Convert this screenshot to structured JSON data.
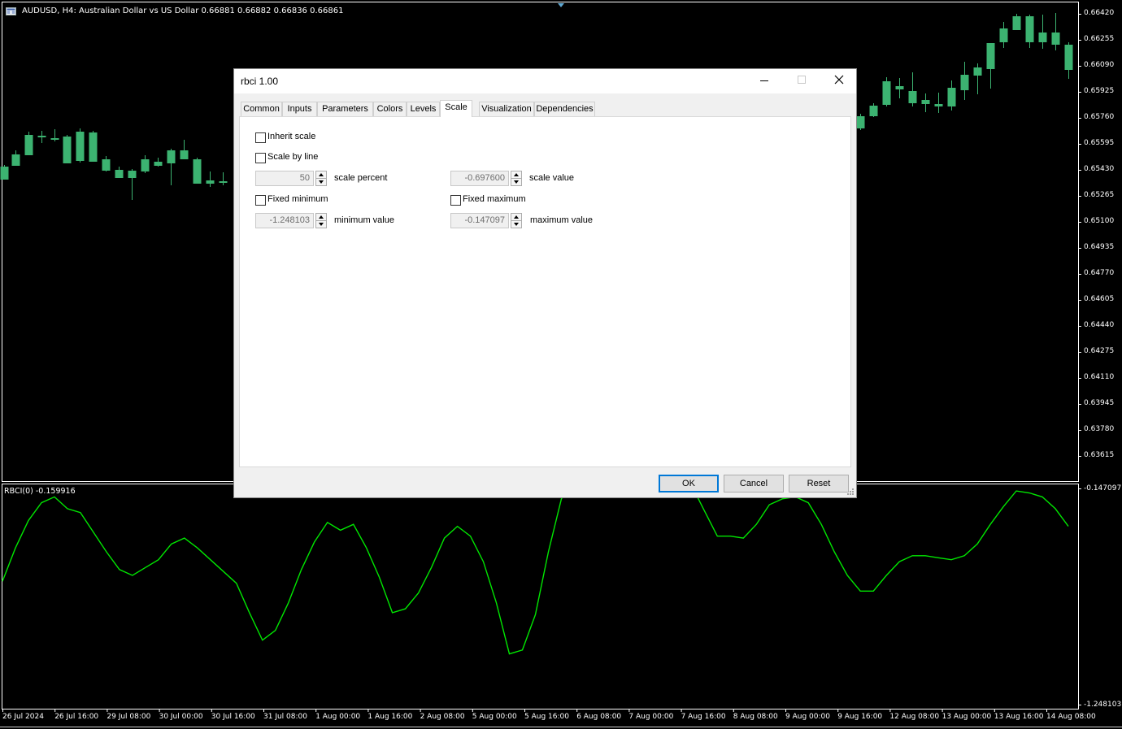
{
  "chart": {
    "title": "AUDUSD, H4:  Australian Dollar vs US Dollar  0.66881 0.66882 0.66836 0.66861",
    "indicator_title": "RBCI(0) -0.159916",
    "colors": {
      "bull": "#3cb371",
      "bear": "#ff3b0f",
      "line": "#00e600",
      "grid": "#ffffff"
    },
    "price_labels": [
      "0.66420",
      "0.66255",
      "0.66090",
      "0.65925",
      "0.65760",
      "0.65595",
      "0.65430",
      "0.65265",
      "0.65100",
      "0.64935",
      "0.64770",
      "0.64605",
      "0.64440",
      "0.64275",
      "0.64110",
      "0.63945",
      "0.63780",
      "0.63615"
    ],
    "indicator_labels": {
      "max": "-0.147097",
      "min": "-1.248103"
    },
    "time_labels": [
      "26 Jul 2024",
      "26 Jul 16:00",
      "29 Jul 08:00",
      "30 Jul 00:00",
      "30 Jul 16:00",
      "31 Jul 08:00",
      "1 Aug 00:00",
      "1 Aug 16:00",
      "2 Aug 08:00",
      "5 Aug 00:00",
      "5 Aug 16:00",
      "6 Aug 08:00",
      "7 Aug 00:00",
      "7 Aug 16:00",
      "8 Aug 08:00",
      "9 Aug 00:00",
      "9 Aug 16:00",
      "12 Aug 08:00",
      "13 Aug 00:00",
      "13 Aug 16:00",
      "14 Aug 08:00"
    ]
  },
  "chart_data": {
    "type": "line",
    "title": "RBCI(0) -0.159916",
    "xlabel": "",
    "ylabel": "",
    "ylim": [
      -1.248103,
      -0.147097
    ],
    "grid": false,
    "series": [
      {
        "values": [
          -0.62,
          -0.45,
          -0.31,
          -0.22,
          -0.19,
          -0.25,
          -0.27,
          -0.37,
          -0.47,
          -0.56,
          -0.59,
          -0.55,
          -0.51,
          -0.43,
          -0.4,
          -0.45,
          -0.51,
          -0.57,
          -0.63,
          -0.78,
          -0.92,
          -0.87,
          -0.73,
          -0.56,
          -0.42,
          -0.32,
          -0.36,
          -0.33,
          -0.45,
          -0.6,
          -0.78,
          -0.76,
          -0.68,
          -0.55,
          -0.4,
          -0.34,
          -0.39,
          -0.52,
          -0.73,
          -0.99,
          -0.97,
          -0.79,
          -0.47,
          -0.2,
          -0.1,
          -0.15,
          -0.1,
          -0.16,
          -0.18,
          -0.17,
          -0.14,
          -0.12,
          -0.09,
          -0.13,
          -0.26,
          -0.39,
          -0.39,
          -0.4,
          -0.33,
          -0.23,
          -0.2,
          -0.19,
          -0.22,
          -0.33,
          -0.47,
          -0.59,
          -0.67,
          -0.67,
          -0.59,
          -0.52,
          -0.49,
          -0.49,
          -0.5,
          -0.51,
          -0.49,
          -0.43,
          -0.33,
          -0.24,
          -0.16,
          -0.17,
          -0.19,
          -0.25,
          -0.34
        ]
      }
    ]
  },
  "dialog": {
    "title": "rbci 1.00",
    "tabs": [
      "Common",
      "Inputs",
      "Parameters",
      "Colors",
      "Levels",
      "Scale",
      "Visualization",
      "Dependencies"
    ],
    "active_tab": "Scale",
    "inherit_scale": {
      "label": "Inherit scale",
      "checked": false
    },
    "scale_by_line": {
      "label": "Scale by line",
      "checked": false
    },
    "scale_percent": {
      "value": "50",
      "label": "scale percent"
    },
    "scale_value": {
      "value": "-0.697600",
      "label": "scale value"
    },
    "fixed_minimum": {
      "label": "Fixed minimum",
      "checked": false
    },
    "fixed_maximum": {
      "label": "Fixed maximum",
      "checked": false
    },
    "minimum_value": {
      "value": "-1.248103",
      "label": "minimum value"
    },
    "maximum_value": {
      "value": "-0.147097",
      "label": "maximum value"
    },
    "buttons": {
      "ok": "OK",
      "cancel": "Cancel",
      "reset": "Reset"
    }
  }
}
